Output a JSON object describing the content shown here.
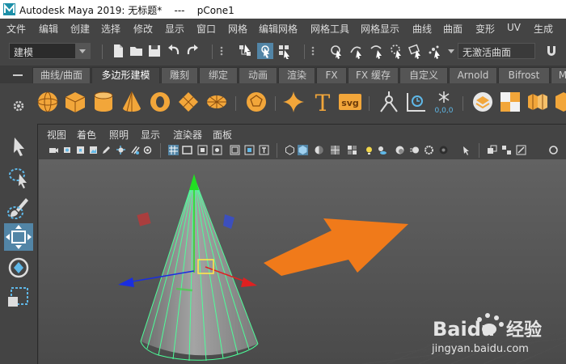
{
  "title": {
    "text": "Autodesk Maya 2019: 无标题*    ---    pCone1"
  },
  "menubar": {
    "items": [
      "文件",
      "编辑",
      "创建",
      "选择",
      "修改",
      "显示",
      "窗口",
      "网格",
      "编辑网格",
      "网格工具",
      "网格显示",
      "曲线",
      "曲面",
      "变形",
      "UV",
      "生成"
    ]
  },
  "toolbar": {
    "mode": "建模",
    "live_surface": "无激活曲面"
  },
  "shelf": {
    "tabs": [
      "曲线/曲面",
      "多边形建模",
      "雕刻",
      "绑定",
      "动画",
      "渲染",
      "FX",
      "FX 缓存",
      "自定义",
      "Arnold",
      "Bifrost",
      "M"
    ],
    "active_tab": "多边形建模",
    "text_icon": "T",
    "svg_icon": "svg",
    "coord_icon": "0,0,0"
  },
  "viewport": {
    "menu": [
      "视图",
      "着色",
      "照明",
      "显示",
      "渲染器",
      "面板"
    ]
  },
  "selected_object": "pCone1",
  "watermark": {
    "brand": "Baidu",
    "brand_cn": "经验",
    "url": "jingyan.baidu.com"
  },
  "colors": {
    "accent": "#5285a6",
    "wireframe": "#4dff9a",
    "arrow": "#f07a1a"
  }
}
